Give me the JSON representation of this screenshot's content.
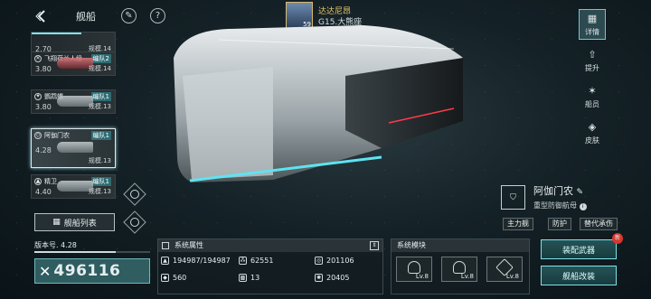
{
  "header": {
    "title": "舰船"
  },
  "commander": {
    "name": "达达尼昂",
    "subtitle": "G15.大熊座",
    "level": "59"
  },
  "ship_list": [
    {
      "level": "2.70",
      "fleet": "",
      "class": "规模.14",
      "name": ""
    },
    {
      "level": "3.80",
      "fleet": "编队2",
      "class": "规模.14",
      "name": "飞翔荷兰人级"
    },
    {
      "level": "3.80",
      "fleet": "编队1",
      "class": "规模.13",
      "name": "鹦鹉螺"
    },
    {
      "level": "4.28",
      "fleet": "编队1",
      "class": "规模.13",
      "name": "阿伽门农"
    },
    {
      "level": "4.40",
      "fleet": "编队1",
      "class": "规模.13",
      "name": "精卫"
    }
  ],
  "fleet_list_label": "舰船列表",
  "right_tabs": [
    {
      "label": "详情",
      "icon": "grid-icon"
    },
    {
      "label": "提升",
      "icon": "upgrade-icon"
    },
    {
      "label": "船员",
      "icon": "crew-icon"
    },
    {
      "label": "皮肤",
      "icon": "skin-icon"
    }
  ],
  "ship": {
    "name": "阿伽门农",
    "type": "重型防御航母",
    "roles": [
      "主力舰",
      "防护",
      "替代承伤"
    ]
  },
  "version": {
    "label": "版本号. 4.28",
    "progress": 0.7
  },
  "power": {
    "value": "496116"
  },
  "attributes": {
    "title": "系统属性",
    "stats": [
      {
        "icon": "hp-icon",
        "value": "194987/194987"
      },
      {
        "icon": "armor-icon",
        "value": "62551"
      },
      {
        "icon": "shield-stat-icon",
        "value": "201106"
      },
      {
        "icon": "speed-icon",
        "value": "560"
      },
      {
        "icon": "slot-icon",
        "value": "13"
      },
      {
        "icon": "energy-icon",
        "value": "20405"
      }
    ]
  },
  "modules": {
    "title": "系统模块",
    "items": [
      {
        "level": "Lv.8"
      },
      {
        "level": "Lv.8"
      },
      {
        "level": "Lv.8"
      }
    ]
  },
  "actions": {
    "equip": "装配武器",
    "refit": "舰船改装",
    "badge": "新"
  }
}
